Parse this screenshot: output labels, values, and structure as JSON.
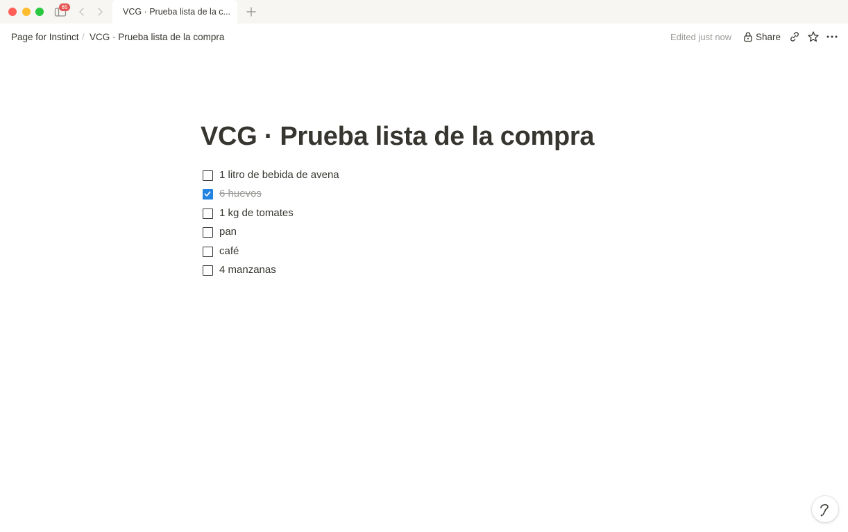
{
  "window": {
    "notification_count": "65",
    "active_tab_label": "VCG · Prueba lista de la c...",
    "icons": [
      "close-window",
      "minimize-window",
      "zoom-window",
      "sidebar-icon",
      "chevron-left-icon",
      "chevron-right-icon",
      "plus-icon"
    ]
  },
  "topbar": {
    "breadcrumb": [
      "Page for Instinct",
      "VCG · Prueba lista de la compra"
    ],
    "breadcrumb_separator": "/",
    "edited_status": "Edited just now",
    "share_label": "Share",
    "icons": [
      "lock-icon",
      "link-icon",
      "star-icon",
      "more-icon"
    ]
  },
  "page": {
    "title": "VCG · Prueba lista de la compra",
    "todos": [
      {
        "text": "1 litro de bebida de avena",
        "checked": false
      },
      {
        "text": "6 huevos",
        "checked": true
      },
      {
        "text": "1 kg de tomates",
        "checked": false
      },
      {
        "text": "pan",
        "checked": false
      },
      {
        "text": "café",
        "checked": false
      },
      {
        "text": "4 manzanas",
        "checked": false
      }
    ]
  },
  "colors": {
    "text": "#37352f",
    "muted": "#9b9a97",
    "checkbox_checked": "#2383e2",
    "badge": "#e55353"
  }
}
